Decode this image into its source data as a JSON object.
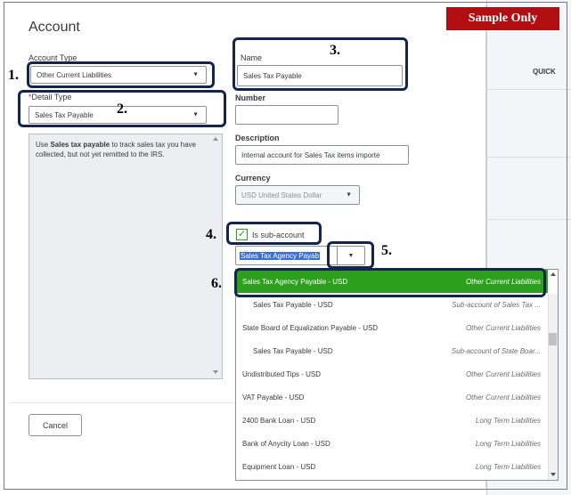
{
  "watermark": "Sample Only",
  "background": {
    "column_header": "QUICK"
  },
  "dialog": {
    "title": "Account",
    "account_type": {
      "label": "Account Type",
      "value": "Other Current Liabilities"
    },
    "detail_type": {
      "label": "Detail Type",
      "required_mark": "*",
      "value": "Sales Tax Payable"
    },
    "detail_description_prefix": "Use ",
    "detail_description_bold": "Sales tax payable",
    "detail_description_suffix": " to track sales tax you have collected, but not yet remitted to the IRS.",
    "name": {
      "label": "Name",
      "value": "Sales Tax Payable"
    },
    "number": {
      "label": "Number",
      "value": ""
    },
    "description": {
      "label": "Description",
      "value": "Internal account for Sales Tax items importe"
    },
    "currency": {
      "label": "Currency",
      "value": "USD United States Dollar"
    },
    "sub_account": {
      "label": "Is sub-account",
      "checked": true,
      "parent_value": "Sales Tax Agency Payab"
    },
    "cancel_label": "Cancel"
  },
  "callouts": [
    "1.",
    "2.",
    "3.",
    "4.",
    "5.",
    "6."
  ],
  "dropdown": {
    "items": [
      {
        "name": "Sales Tax Agency Payable - USD",
        "type": "Other Current Liabilities",
        "indent": false,
        "selected": true
      },
      {
        "name": "Sales Tax Payable - USD",
        "type": "Sub-account of Sales Tax ...",
        "indent": true,
        "selected": false
      },
      {
        "name": "State Board of Equalization Payable - USD",
        "type": "Other Current Liabilities",
        "indent": false,
        "selected": false
      },
      {
        "name": "Sales Tax Payable - USD",
        "type": "Sub-account of State Boar...",
        "indent": true,
        "selected": false
      },
      {
        "name": "Undistributed Tips - USD",
        "type": "Other Current Liabilities",
        "indent": false,
        "selected": false
      },
      {
        "name": "VAT Payable - USD",
        "type": "Other Current Liabilities",
        "indent": false,
        "selected": false
      },
      {
        "name": "2400 Bank Loan - USD",
        "type": "Long Term Liabilities",
        "indent": false,
        "selected": false
      },
      {
        "name": "Bank of Anycity Loan - USD",
        "type": "Long Term Liabilities",
        "indent": false,
        "selected": false
      },
      {
        "name": "Equipment Loan - USD",
        "type": "Long Term Liabilities",
        "indent": false,
        "selected": false
      }
    ]
  },
  "colors": {
    "accent": "#2ca01c",
    "callout": "#14254d",
    "watermark_bg": "#b10e12"
  }
}
